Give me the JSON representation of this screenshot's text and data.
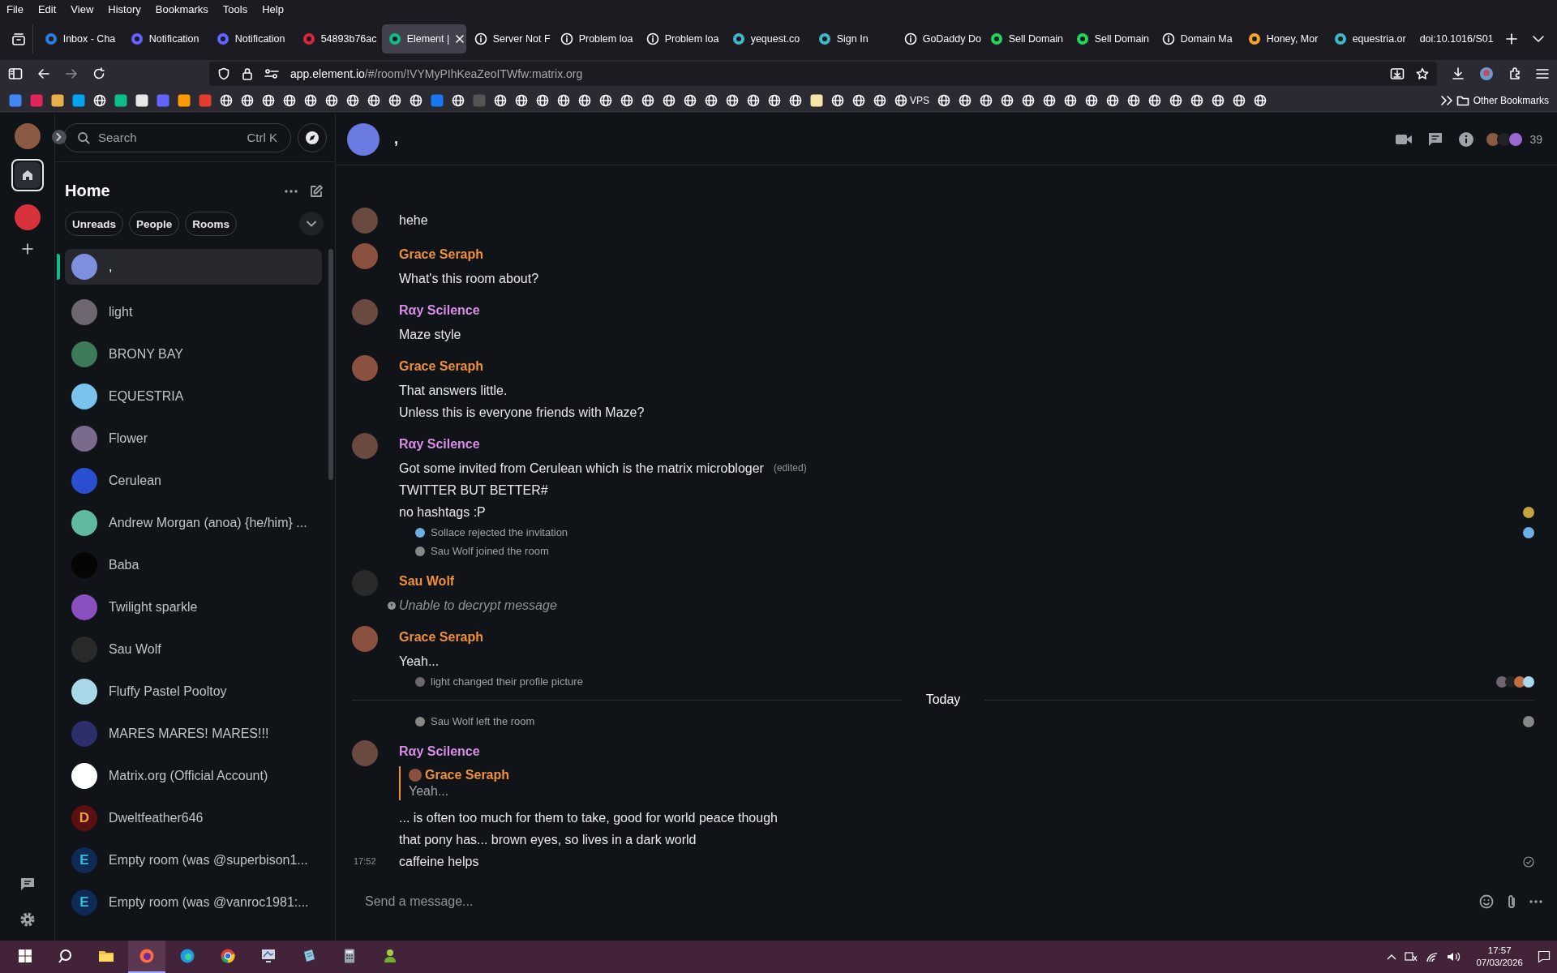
{
  "menu_bar": [
    "File",
    "Edit",
    "View",
    "History",
    "Bookmarks",
    "Tools",
    "Help"
  ],
  "browser_tabs": [
    {
      "label": "Inbox - Cha",
      "kind": "favicon",
      "color": "#2a7de1",
      "selected": false
    },
    {
      "label": "Notification",
      "kind": "favicon",
      "color": "#6364ff",
      "selected": false
    },
    {
      "label": "Notification",
      "kind": "favicon",
      "color": "#6364ff",
      "selected": false
    },
    {
      "label": "54893b76ac",
      "kind": "favicon",
      "color": "#d9263a",
      "selected": false
    },
    {
      "label": "Element |",
      "kind": "favicon",
      "color": "#0dbd8b",
      "selected": true
    },
    {
      "label": "Server Not F",
      "kind": "info",
      "selected": false
    },
    {
      "label": "Problem loa",
      "kind": "info",
      "selected": false
    },
    {
      "label": "Problem loa",
      "kind": "info",
      "selected": false
    },
    {
      "label": "yequest.co",
      "kind": "favicon",
      "color": "#3fb8c8",
      "selected": false
    },
    {
      "label": "Sign In",
      "kind": "favicon",
      "color": "#3fb8c8",
      "selected": false
    },
    {
      "label": "GoDaddy Do",
      "kind": "info",
      "selected": false
    },
    {
      "label": "Sell Domain",
      "kind": "favicon",
      "color": "#1ed760",
      "selected": false
    },
    {
      "label": "Sell Domain",
      "kind": "favicon",
      "color": "#1ed760",
      "selected": false
    },
    {
      "label": "Domain Ma",
      "kind": "info",
      "selected": false
    },
    {
      "label": "Honey, Mor",
      "kind": "favicon",
      "color": "#f5a623",
      "selected": false
    },
    {
      "label": "equestria.or",
      "kind": "favicon",
      "color": "#3fb8c8",
      "selected": false
    },
    {
      "label": "doi:10.1016/S01",
      "kind": "none",
      "selected": false
    }
  ],
  "address_bar": {
    "host": "app.element.io",
    "path": "/#/room/!VYMyPIhKeaZeoITWfw:matrix.org"
  },
  "bookmarks": [
    {
      "kind": "site",
      "color": "#4285f4"
    },
    {
      "kind": "site",
      "color": "#e0245e"
    },
    {
      "kind": "site",
      "color": "#e8b04a"
    },
    {
      "kind": "site",
      "color": "#00a4ef"
    },
    {
      "kind": "globe"
    },
    {
      "kind": "site",
      "color": "#0dbd8b"
    },
    {
      "kind": "site",
      "color": "#e8e8e8"
    },
    {
      "kind": "site",
      "color": "#6364ff"
    },
    {
      "kind": "site",
      "color": "#ff9900"
    },
    {
      "kind": "site",
      "color": "#e33b2e"
    },
    {
      "kind": "globe"
    },
    {
      "kind": "globe"
    },
    {
      "kind": "globe"
    },
    {
      "kind": "globe"
    },
    {
      "kind": "globe"
    },
    {
      "kind": "globe"
    },
    {
      "kind": "globe"
    },
    {
      "kind": "globe"
    },
    {
      "kind": "globe"
    },
    {
      "kind": "globe"
    },
    {
      "kind": "site",
      "color": "#1877f2"
    },
    {
      "kind": "globe"
    },
    {
      "kind": "site",
      "color": "#555555"
    },
    {
      "kind": "globe"
    },
    {
      "kind": "globe"
    },
    {
      "kind": "globe"
    },
    {
      "kind": "globe"
    },
    {
      "kind": "globe"
    },
    {
      "kind": "globe"
    },
    {
      "kind": "globe"
    },
    {
      "kind": "globe"
    },
    {
      "kind": "globe"
    },
    {
      "kind": "globe"
    },
    {
      "kind": "globe"
    },
    {
      "kind": "globe"
    },
    {
      "kind": "globe"
    },
    {
      "kind": "globe"
    },
    {
      "kind": "globe"
    },
    {
      "kind": "site",
      "color": "#f5e6a8"
    },
    {
      "kind": "globe"
    },
    {
      "kind": "globe"
    },
    {
      "kind": "globe"
    },
    {
      "kind": "globe",
      "label": "VPS"
    },
    {
      "kind": "globe"
    },
    {
      "kind": "globe"
    },
    {
      "kind": "globe"
    },
    {
      "kind": "globe"
    },
    {
      "kind": "globe"
    },
    {
      "kind": "globe"
    },
    {
      "kind": "globe"
    },
    {
      "kind": "globe"
    },
    {
      "kind": "globe"
    },
    {
      "kind": "globe"
    },
    {
      "kind": "globe"
    },
    {
      "kind": "globe"
    },
    {
      "kind": "globe"
    },
    {
      "kind": "globe"
    },
    {
      "kind": "globe"
    },
    {
      "kind": "globe"
    }
  ],
  "other_bookmarks": "Other Bookmarks",
  "spaces": [
    {
      "kind": "home",
      "selected": true
    },
    {
      "kind": "space",
      "color": "#d8323c",
      "selected": false
    }
  ],
  "room_list": {
    "search": {
      "placeholder": "Search",
      "shortcut": "Ctrl K"
    },
    "title": "Home",
    "filters": [
      {
        "label": "Unreads",
        "selected": false
      },
      {
        "label": "People",
        "selected": false
      },
      {
        "label": "Rooms",
        "selected": false
      }
    ],
    "rooms": [
      {
        "name": ",",
        "kind": "image",
        "color": "#7f8fe0",
        "selected": true
      },
      {
        "name": "light",
        "kind": "image",
        "color": "#6e6670",
        "selected": false
      },
      {
        "name": "BRONY BAY",
        "kind": "image",
        "color": "#3c7a5a",
        "selected": false
      },
      {
        "name": "EQUESTRIA",
        "kind": "image",
        "color": "#79c4ec",
        "selected": false
      },
      {
        "name": "Flower",
        "kind": "image",
        "color": "#7a6a8c",
        "selected": false
      },
      {
        "name": "Cerulean",
        "kind": "image",
        "color": "#2a4fd0",
        "selected": false
      },
      {
        "name": "Andrew Morgan (anoa) {he/him} ...",
        "kind": "image",
        "color": "#5fb8a0",
        "selected": false
      },
      {
        "name": "Baba",
        "kind": "image",
        "color": "#050505",
        "selected": false
      },
      {
        "name": "Twilight sparkle",
        "kind": "image",
        "color": "#8a4fc0",
        "selected": false
      },
      {
        "name": "Sau Wolf",
        "kind": "image",
        "color": "#2a2a2a",
        "selected": false
      },
      {
        "name": "Fluffy Pastel Pooltoy",
        "kind": "image",
        "color": "#a9d8e8",
        "selected": false
      },
      {
        "name": "MARES MARES! MARES!!!",
        "kind": "image",
        "color": "#2c2f6a",
        "selected": false
      },
      {
        "name": "Matrix.org (Official Account)",
        "kind": "image",
        "color": "#ffffff",
        "selected": false
      },
      {
        "name": "Dweltfeather646",
        "kind": "letter",
        "letter": "D",
        "color": "#5a1010",
        "selected": false
      },
      {
        "name": "Empty room (was @superbison1...",
        "kind": "letter",
        "letter": "E",
        "color": "#0e2a55",
        "selected": false
      },
      {
        "name": "Empty room (was @vanroc1981:...",
        "kind": "letter",
        "letter": "E",
        "color": "#0e2a55",
        "selected": false
      }
    ]
  },
  "room_header": {
    "name": ",",
    "member_count": "39"
  },
  "timeline": [
    {
      "kind": "message",
      "avatar": {
        "color": "#6a4a40"
      },
      "lines": [
        {
          "text": "hehe"
        }
      ]
    },
    {
      "kind": "message",
      "sender": {
        "name": "Grace Seraph",
        "color": "#f0913a"
      },
      "avatar": {
        "color": "#8a5040"
      },
      "lines": [
        {
          "text": "What's this room about?"
        }
      ]
    },
    {
      "kind": "message",
      "sender": {
        "name": "Rαy Scilence",
        "color": "#d88ee6"
      },
      "avatar": {
        "color": "#6a4a40"
      },
      "lines": [
        {
          "text": "Maze style"
        }
      ]
    },
    {
      "kind": "message",
      "sender": {
        "name": "Grace Seraph",
        "color": "#f0913a"
      },
      "avatar": {
        "color": "#8a5040"
      },
      "lines": [
        {
          "text": "That answers little."
        },
        {
          "text": "Unless this is everyone friends with Maze?"
        }
      ]
    },
    {
      "kind": "message",
      "sender": {
        "name": "Rαy Scilence",
        "color": "#d88ee6"
      },
      "avatar": {
        "color": "#6a4a40"
      },
      "lines": [
        {
          "text": "Got some invited from Cerulean which is the matrix microbloger",
          "note": "(edited)"
        },
        {
          "text": "TWITTER BUT BETTER#"
        },
        {
          "text": "no hashtags :P",
          "receipts": [
            {
              "color": "#c9a040"
            }
          ]
        }
      ]
    },
    {
      "kind": "event",
      "text": "Sollace rejected the invitation",
      "avatar": {
        "color": "#6ab0e0"
      },
      "receipts": [
        {
          "color": "#6ab0e0"
        }
      ]
    },
    {
      "kind": "event",
      "text": "Sau Wolf joined the room",
      "avatar": {
        "color": "#888888"
      }
    },
    {
      "kind": "message",
      "sender": {
        "name": "Sau Wolf",
        "color": "#f0913a"
      },
      "avatar": {
        "color": "#2a2a2a"
      },
      "lines": [
        {
          "text": "Unable to decrypt message",
          "kind": "undecryptable"
        }
      ]
    },
    {
      "kind": "message",
      "sender": {
        "name": "Grace Seraph",
        "color": "#f0913a"
      },
      "avatar": {
        "color": "#8a5040"
      },
      "lines": [
        {
          "text": "Yeah..."
        }
      ]
    },
    {
      "kind": "event",
      "text": "light changed their profile picture",
      "avatar": {
        "color": "#6e6670"
      },
      "receipts": [
        {
          "color": "#6e6670"
        },
        {
          "color": "#222222"
        },
        {
          "color": "#c07040"
        },
        {
          "color": "#a9d8e8"
        }
      ]
    },
    {
      "kind": "divider",
      "label": "Today"
    },
    {
      "kind": "event",
      "text": "Sau Wolf left the room",
      "avatar": {
        "color": "#888888"
      },
      "receipts": [
        {
          "color": "#888888"
        }
      ]
    },
    {
      "kind": "message",
      "sender": {
        "name": "Rαy Scilence",
        "color": "#d88ee6"
      },
      "avatar": {
        "color": "#6a4a40"
      },
      "quote": {
        "sender": {
          "name": "Grace Seraph",
          "color": "#f0913a"
        },
        "text": "Yeah..."
      },
      "lines": [
        {
          "text": "... is often too much for them to take, good for world peace though"
        },
        {
          "text": "that pony has... brown eyes, so lives in a dark world"
        },
        {
          "text": "caffeine helps",
          "time": "17:52",
          "sent": true
        }
      ]
    }
  ],
  "composer": {
    "placeholder": "Send a message..."
  },
  "taskbar": {
    "apps": [
      {
        "kind": "search",
        "selected": false
      },
      {
        "kind": "folder",
        "selected": false
      },
      {
        "kind": "firefox",
        "selected": true
      },
      {
        "kind": "edge",
        "selected": false
      },
      {
        "kind": "chrome",
        "selected": false
      },
      {
        "kind": "monitor",
        "selected": false
      },
      {
        "kind": "notes",
        "selected": false
      },
      {
        "kind": "calculator",
        "selected": false
      },
      {
        "kind": "person",
        "selected": false
      }
    ],
    "time": "17:57",
    "date": "07/03/2026"
  }
}
